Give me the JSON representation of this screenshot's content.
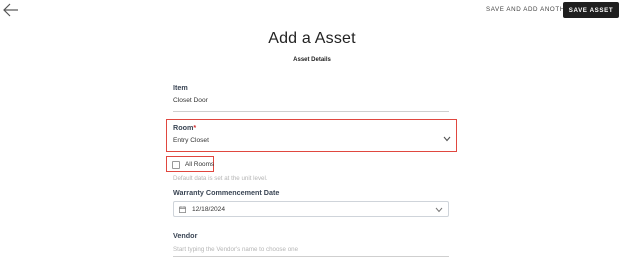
{
  "header": {
    "save_and_add_another": "SAVE AND ADD ANOTHER",
    "save_asset": "SAVE ASSET"
  },
  "page": {
    "title": "Add a Asset",
    "section_title": "Asset Details"
  },
  "form": {
    "item": {
      "label": "Item",
      "value": "Closet Door"
    },
    "room": {
      "label": "Room",
      "required_mark": "*",
      "value": "Entry Closet"
    },
    "all_rooms": {
      "label": "All Rooms",
      "checked": false
    },
    "helper_text": "Default data is set at the unit level.",
    "warranty": {
      "label": "Warranty Commencement Date",
      "value": "12/18/2024"
    },
    "vendor": {
      "label": "Vendor",
      "placeholder": "Start typing the Vendor's name to choose one"
    }
  },
  "icons": {
    "back": "arrow-left-icon",
    "room_dropdown": "chevron-down-icon",
    "calendar": "calendar-icon",
    "date_dropdown": "chevron-down-icon",
    "checkbox": "checkbox-icon"
  },
  "colors": {
    "primary_button_bg": "#1f1f1f",
    "highlight_outline": "#e0473f",
    "label_text": "#3b4655",
    "required_mark": "#d32f2f"
  }
}
